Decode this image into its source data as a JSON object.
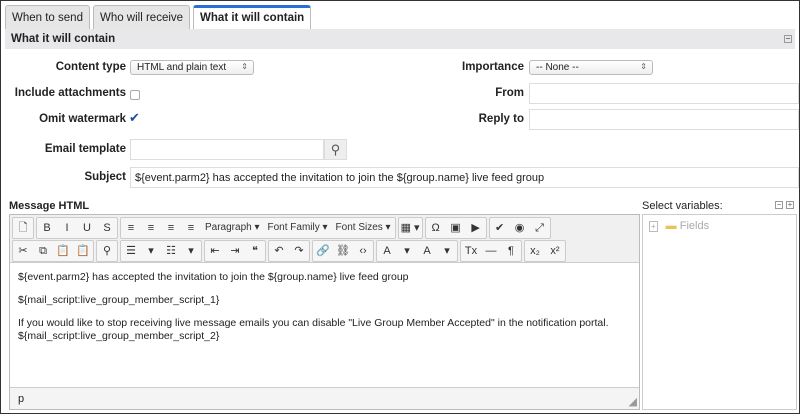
{
  "tabs": [
    "When to send",
    "Who will receive",
    "What it will contain"
  ],
  "section": {
    "title": "What it will contain"
  },
  "form": {
    "content_type_label": "Content type",
    "content_type_value": "HTML and plain text",
    "importance_label": "Importance",
    "importance_value": "-- None --",
    "include_attachments_label": "Include attachments",
    "include_attachments_checked": false,
    "from_label": "From",
    "from_value": "",
    "omit_watermark_label": "Omit watermark",
    "omit_watermark_checked": true,
    "reply_to_label": "Reply to",
    "reply_to_value": "",
    "email_template_label": "Email template",
    "email_template_value": "",
    "subject_label": "Subject",
    "subject_value": "${event.parm2} has accepted the invitation to join the ${group.name} live feed group"
  },
  "message": {
    "label": "Message HTML",
    "toolbar_row1": [
      [
        "new-document|🗋"
      ],
      [
        "bold|B",
        "italic|I",
        "underline|U",
        "strikethrough|S"
      ],
      [
        "align-left|≡",
        "align-center|≡",
        "align-right|≡",
        "justify|≡",
        "paragraph-dropdown|Paragraph ▾",
        "font-family-dropdown|Font Family ▾",
        "font-sizes-dropdown|Font Sizes ▾"
      ],
      [
        "table|▦ ▾"
      ],
      [
        "special-char|Ω",
        "image|▣",
        "media|▶"
      ],
      [
        "spellcheck|✔",
        "preview|◉",
        "fullscreen|⤢"
      ]
    ],
    "toolbar_row2": [
      [
        "cut|✂",
        "copy|⧉",
        "paste|📋",
        "paste-text|📋"
      ],
      [
        "find|⚲"
      ],
      [
        "bullet-list|☰",
        "bullet-list-dropdown|▾",
        "numbered-list|☷",
        "numbered-list-dropdown|▾"
      ],
      [
        "outdent|⇤",
        "indent|⇥",
        "blockquote|❝"
      ],
      [
        "undo|↶",
        "redo|↷"
      ],
      [
        "link|🔗",
        "unlink|⛓",
        "code|‹›"
      ],
      [
        "text-color|A",
        "text-color-dropdown|▾",
        "background-color|A",
        "background-color-dropdown|▾"
      ],
      [
        "clear-format|Tx",
        "horizontal-rule|—",
        "show-blocks|¶"
      ],
      [
        "subscript|x₂",
        "superscript|x²"
      ]
    ],
    "paragraphs": [
      "${event.parm2} has accepted the invitation to join the ${group.name} live feed group",
      "${mail_script:live_group_member_script_1}",
      "If you would like to stop receiving live message emails you can disable \"Live Group Member Accepted\" in the notification portal.",
      "${mail_script:live_group_member_script_2}"
    ],
    "status_path": "p"
  },
  "variables": {
    "label": "Select variables:",
    "tree": [
      {
        "label": "Fields"
      }
    ]
  }
}
